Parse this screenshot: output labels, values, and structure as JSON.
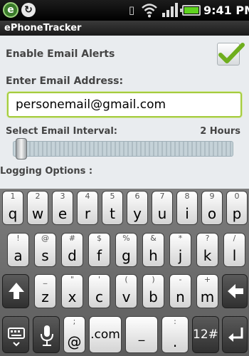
{
  "status_bar": {
    "app_icon_letter": "e",
    "time": "9:41 PM"
  },
  "app": {
    "title": "ePhoneTracker"
  },
  "settings": {
    "email_alerts_label": "Enable Email Alerts",
    "email_alerts_checked": true,
    "email_address_label": "Enter Email Address:",
    "email_address_value": "personemail@gmail.com",
    "email_interval_label": "Select Email Interval:",
    "email_interval_value": "2 Hours",
    "logging_options_label": "Logging Options :"
  },
  "keyboard": {
    "row1": [
      {
        "main": "q",
        "alt": "1"
      },
      {
        "main": "w",
        "alt": "2"
      },
      {
        "main": "e",
        "alt": "3"
      },
      {
        "main": "r",
        "alt": "4"
      },
      {
        "main": "t",
        "alt": "5"
      },
      {
        "main": "y",
        "alt": "6"
      },
      {
        "main": "u",
        "alt": "7"
      },
      {
        "main": "i",
        "alt": "8"
      },
      {
        "main": "o",
        "alt": "9"
      },
      {
        "main": "p",
        "alt": "0"
      }
    ],
    "row2": [
      {
        "main": "a",
        "alt": "!"
      },
      {
        "main": "s",
        "alt": "@"
      },
      {
        "main": "d",
        "alt": "#"
      },
      {
        "main": "f",
        "alt": "$"
      },
      {
        "main": "g",
        "alt": "%"
      },
      {
        "main": "h",
        "alt": "&"
      },
      {
        "main": "j",
        "alt": "*"
      },
      {
        "main": "k",
        "alt": "?"
      },
      {
        "main": "l",
        "alt": "/"
      }
    ],
    "row3": [
      {
        "main": "z",
        "alt": "_"
      },
      {
        "main": "x",
        "alt": "\""
      },
      {
        "main": "c",
        "alt": "'"
      },
      {
        "main": "v",
        "alt": "("
      },
      {
        "main": "b",
        "alt": ")"
      },
      {
        "main": "n",
        "alt": "-"
      },
      {
        "main": "m",
        "alt": "+"
      }
    ],
    "shift_icon": "shift-arrow-icon",
    "backspace_icon": "backspace-arrow-icon",
    "keyboard_icon": "keyboard-icon",
    "mic_icon": "microphone-icon",
    "enter_icon": "enter-arrow-icon",
    "at_key": {
      "main": "@",
      "alt": ";"
    },
    "dotcom_key": ".com",
    "space_key": "_",
    "colon_key": {
      "main": ".",
      "alt": ":"
    },
    "symbols_key": "12#"
  },
  "colors": {
    "focus_border": "#a5cc3f",
    "checkmark": "#6fae1e",
    "battery": "#5fd31f"
  }
}
